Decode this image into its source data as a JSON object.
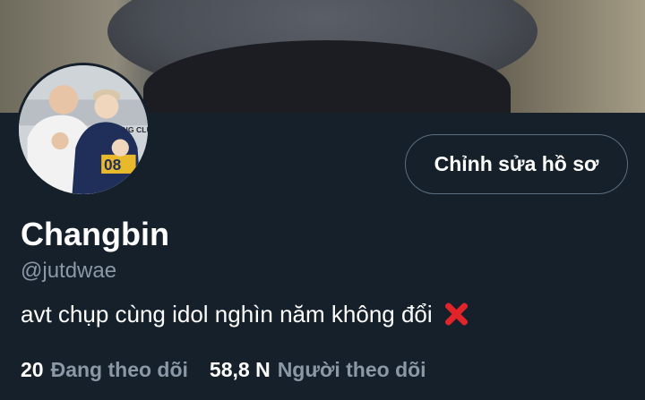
{
  "profile": {
    "display_name": "Changbin",
    "handle": "@jutdwae",
    "bio": "avt chụp cùng idol nghìn năm không đổi",
    "bio_emoji": "cross-mark-icon",
    "edit_button_label": "Chỉnh sửa hồ sơ"
  },
  "stats": {
    "following_count": "20",
    "following_label": "Đang theo dõi",
    "followers_count": "58,8 N",
    "followers_label": "Người theo dõi"
  },
  "avatar_photo_text": "ING CLU",
  "colors": {
    "background": "#15202b",
    "secondary_text": "#8b98a5",
    "button_border": "#5c6e7e",
    "cross_mark": "#e0242a"
  }
}
